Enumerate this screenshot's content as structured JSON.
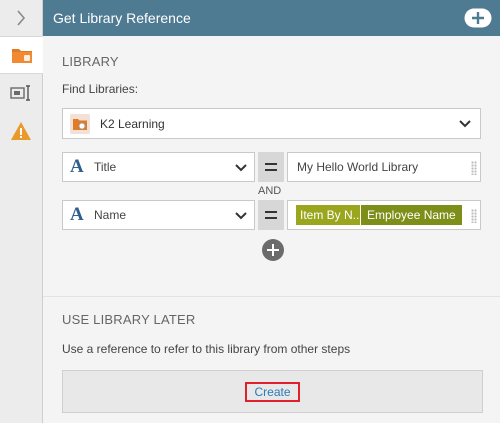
{
  "header": {
    "title": "Get Library Reference"
  },
  "rail": {
    "tabs": [
      "library-folder-icon",
      "text-cursor-icon",
      "warning-icon"
    ]
  },
  "library": {
    "section_title": "LIBRARY",
    "find_label": "Find Libraries:",
    "selected_library": "K2 Learning"
  },
  "filters": [
    {
      "field": "Title",
      "operator": "=",
      "value": "My Hello World Library"
    },
    {
      "field": "Name",
      "operator": "=",
      "tokens": [
        "Item By N...",
        "Employee Name"
      ]
    }
  ],
  "conjunction": "AND",
  "later": {
    "section_title": "USE LIBRARY LATER",
    "description": "Use a reference to refer to this library from other steps",
    "create_label": "Create"
  },
  "colors": {
    "header_bg": "#4f7b92",
    "accent_orange": "#e07b27",
    "token_primary": "#9aa71e",
    "token_secondary": "#7d8f19",
    "highlight_red": "#e0202a",
    "link_blue": "#2a7ab8"
  }
}
